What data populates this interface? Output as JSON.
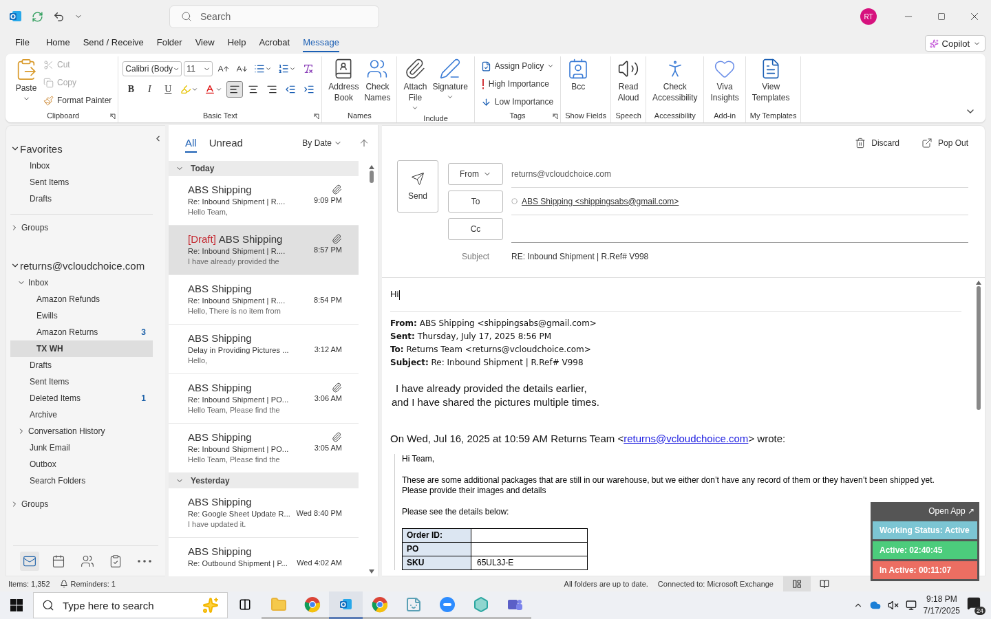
{
  "title_bar": {
    "search_placeholder": "Search",
    "avatar": "RT"
  },
  "menu_tabs": [
    {
      "label": "File",
      "selected": false
    },
    {
      "label": "Home",
      "selected": false
    },
    {
      "label": "Send / Receive",
      "selected": false
    },
    {
      "label": "Folder",
      "selected": false
    },
    {
      "label": "View",
      "selected": false
    },
    {
      "label": "Help",
      "selected": false
    },
    {
      "label": "Acrobat",
      "selected": false
    },
    {
      "label": "Message",
      "selected": true
    }
  ],
  "copilot": "Copilot",
  "ribbon": [
    {
      "label": "Clipboard",
      "kind": "clipboard",
      "launcher": true,
      "items": [
        {
          "label": "Paste",
          "disabled": false
        },
        {
          "label": "Cut",
          "disabled": true
        },
        {
          "label": "Copy",
          "disabled": true
        },
        {
          "label": "Format Painter",
          "disabled": false
        }
      ]
    },
    {
      "label": "Basic Text",
      "kind": "font",
      "launcher": true,
      "font": "Calibri (Body",
      "size": "11",
      "styles": [
        "B",
        "I",
        "U"
      ],
      "alignment": [
        {
          "selected": true
        },
        {
          "selected": false
        },
        {
          "selected": false
        }
      ]
    },
    {
      "label": "Names",
      "kind": "large",
      "launcher": false,
      "items": [
        {
          "label": "Address\nBook",
          "dropdown": false
        },
        {
          "label": "Check\nNames",
          "dropdown": false
        }
      ]
    },
    {
      "label": "Include",
      "kind": "large",
      "launcher": false,
      "items": [
        {
          "label": "Attach\nFile",
          "dropdown": true
        },
        {
          "label": "Signature",
          "dropdown": true
        }
      ]
    },
    {
      "label": "Tags",
      "kind": "small",
      "launcher": true,
      "items": [
        {
          "label": "Assign Policy",
          "dropdown": true
        },
        {
          "label": "High Importance",
          "dropdown": false
        },
        {
          "label": "Low Importance",
          "dropdown": false
        }
      ]
    },
    {
      "label": "Show Fields",
      "kind": "large",
      "launcher": false,
      "items": [
        {
          "label": "Bcc",
          "dropdown": false
        }
      ]
    },
    {
      "label": "Speech",
      "kind": "large",
      "launcher": false,
      "items": [
        {
          "label": "Read\nAloud",
          "dropdown": false
        }
      ]
    },
    {
      "label": "Accessibility",
      "kind": "large",
      "launcher": false,
      "items": [
        {
          "label": "Check\nAccessibility",
          "dropdown": false
        }
      ]
    },
    {
      "label": "Add-in",
      "kind": "large",
      "launcher": false,
      "items": [
        {
          "label": "Viva\nInsights",
          "dropdown": false
        }
      ]
    },
    {
      "label": "My Templates",
      "kind": "large",
      "launcher": false,
      "items": [
        {
          "label": "View\nTemplates",
          "dropdown": false
        }
      ]
    }
  ],
  "nav": {
    "sections": [
      {
        "label": "Favorites",
        "kind": "header",
        "expanded": true,
        "children": [
          {
            "label": "Inbox",
            "selected": false
          },
          {
            "label": "Sent Items",
            "selected": false
          },
          {
            "label": "Drafts",
            "selected": false
          }
        ]
      },
      {
        "label": "Groups",
        "kind": "group",
        "expanded": false
      },
      {
        "label": "returns@vcloudchoice.com",
        "kind": "header",
        "expanded": true,
        "children": [
          {
            "label": "Inbox",
            "selected": false,
            "expanded": true,
            "children": [
              {
                "label": "Amazon Refunds",
                "selected": false
              },
              {
                "label": "Ewills",
                "selected": false
              },
              {
                "label": "Amazon Returns",
                "selected": false,
                "count": "3"
              },
              {
                "label": "TX WH",
                "selected": true
              }
            ]
          },
          {
            "label": "Drafts",
            "selected": false
          },
          {
            "label": "Sent Items",
            "selected": false
          },
          {
            "label": "Deleted Items",
            "selected": false,
            "count": "1"
          },
          {
            "label": "Archive",
            "selected": false
          },
          {
            "label": "Conversation History",
            "selected": false,
            "expanded": false
          },
          {
            "label": "Junk Email",
            "selected": false
          },
          {
            "label": "Outbox",
            "selected": false
          },
          {
            "label": "Search Folders",
            "selected": false
          }
        ]
      },
      {
        "label": "Groups",
        "kind": "group",
        "expanded": false
      }
    ],
    "modules": [
      {
        "selected": true
      },
      {
        "selected": false
      },
      {
        "selected": false
      },
      {
        "selected": false
      },
      {
        "selected": false
      }
    ]
  },
  "message_list": {
    "filters": [
      {
        "label": "All",
        "selected": true
      },
      {
        "label": "Unread",
        "selected": false
      }
    ],
    "sort": "By Date",
    "groups": [
      {
        "label": "Today",
        "expanded": true,
        "messages": [
          {
            "sender": "ABS Shipping",
            "subject": "Re: Inbound Shipment | R....",
            "time": "9:09 PM",
            "preview": "Hello Team,",
            "attachment": true,
            "selected": false
          },
          {
            "tag": "[Draft]",
            "sender": "ABS Shipping",
            "subject": "Re: Inbound Shipment | R....",
            "time": "8:57 PM",
            "preview": "I have already provided the",
            "attachment": true,
            "selected": true
          },
          {
            "sender": "ABS Shipping",
            "subject": "Re: Inbound Shipment | R....",
            "time": "8:54 PM",
            "preview": "Hello,  There is no item from",
            "attachment": false,
            "selected": false
          },
          {
            "sender": "ABS Shipping",
            "subject": "Delay in Providing Pictures ...",
            "time": "3:12 AM",
            "preview": "Hello,",
            "attachment": false,
            "selected": false
          },
          {
            "sender": "ABS Shipping",
            "subject": "Re: Inbound Shipment | PO...",
            "time": "3:06 AM",
            "preview": "Hello Team,  Please find the",
            "attachment": true,
            "selected": false
          },
          {
            "sender": "ABS Shipping",
            "subject": "Re: Inbound Shipment | PO...",
            "time": "3:05 AM",
            "preview": "Hello Team,  Please find the",
            "attachment": true,
            "selected": false
          }
        ]
      },
      {
        "label": "Yesterday",
        "expanded": true,
        "messages": [
          {
            "sender": "ABS Shipping",
            "subject": "Re: Google Sheet Update R...",
            "time": "Wed 8:40 PM",
            "preview": "I have updated it.",
            "attachment": false,
            "selected": false
          },
          {
            "sender": "ABS Shipping",
            "subject": "Re: Outbound Shipment | P...",
            "time": "Wed 4:02 AM",
            "attachment": false,
            "selected": false
          }
        ]
      }
    ]
  },
  "compose": {
    "actions": [
      "Discard",
      "Pop Out"
    ],
    "send": "Send",
    "from": {
      "label": "From",
      "value": "returns@vcloudchoice.com"
    },
    "to": {
      "label": "To",
      "value": "ABS Shipping <shippingsabs@gmail.com>"
    },
    "cc": {
      "label": "Cc"
    },
    "subject": {
      "label": "Subject",
      "value": "RE: Inbound Shipment | R.Ref# V998"
    },
    "body": {
      "greeting": "Hi",
      "header": [
        "**From:** ABS Shipping <shippingsabs@gmail.com>",
        "**Sent:** Thursday, July 17, 2025 8:56 PM",
        "**To:** Returns Team <returns@vcloudchoice.com>",
        "**Subject:** Re: Inbound Shipment | R.Ref# V998"
      ],
      "reply": [
        "I have already provided the details earlier,",
        "and I have shared the pictures multiple times."
      ],
      "quote_intro": {
        "before": "On Wed, Jul 16, 2025 at 10:59 AM Returns Team <",
        "link": "returns@vcloudchoice.com",
        "after": "> wrote:"
      },
      "quoted": [
        "Hi Team,",
        "These are some additional packages that are still in our warehouse, but we either don’t have any record of them or they haven’t been shipped yet. Please provide their images and details",
        "Please see the details below:"
      ],
      "table": [
        {
          "label": "Order ID:"
        },
        {
          "label": "PO"
        },
        {
          "label": "SKU",
          "value": "65UL3J-E"
        }
      ]
    }
  },
  "widget": {
    "open_app": "Open App ↗",
    "statuses": [
      {
        "text": "Working Status: Active",
        "color": "#7cc5d3"
      },
      {
        "text": "Active: 02:40:45",
        "color": "#4ccc7c"
      },
      {
        "text": "In Active: 00:11:07",
        "color": "#ec6e62"
      }
    ]
  },
  "status_bar": {
    "items": "Items: 1,352",
    "reminders": "Reminders: 1",
    "sync": "All folders are up to date.",
    "connection": "Connected to: Microsoft Exchange",
    "views": [
      {
        "selected": true
      },
      {
        "selected": false
      }
    ]
  },
  "taskbar": {
    "search_placeholder": "Type here to search",
    "apps": [
      {
        "selected": false
      },
      {
        "selected": false
      },
      {
        "selected": false
      },
      {
        "selected": true
      },
      {
        "selected": false
      },
      {
        "selected": false
      },
      {
        "selected": false
      },
      {
        "selected": false
      },
      {
        "selected": false
      }
    ],
    "time": "9:18 PM",
    "date": "7/17/2025",
    "notifications": "24"
  }
}
